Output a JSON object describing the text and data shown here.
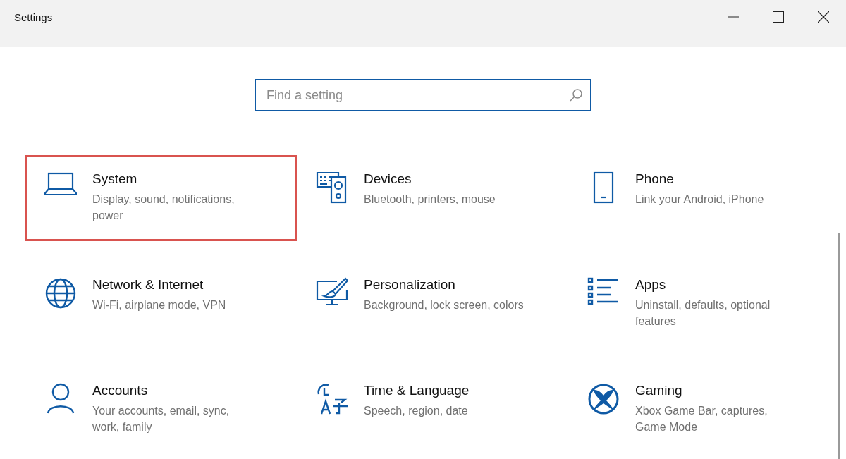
{
  "window": {
    "title": "Settings"
  },
  "search": {
    "placeholder": "Find a setting"
  },
  "categories": [
    {
      "kind": "system",
      "title": "System",
      "subtitle": "Display, sound, notifications, power",
      "highlighted": true
    },
    {
      "kind": "devices",
      "title": "Devices",
      "subtitle": "Bluetooth, printers, mouse",
      "highlighted": false
    },
    {
      "kind": "phone",
      "title": "Phone",
      "subtitle": "Link your Android, iPhone",
      "highlighted": false
    },
    {
      "kind": "network",
      "title": "Network & Internet",
      "subtitle": "Wi-Fi, airplane mode, VPN",
      "highlighted": false
    },
    {
      "kind": "personalization",
      "title": "Personalization",
      "subtitle": "Background, lock screen, colors",
      "highlighted": false
    },
    {
      "kind": "apps",
      "title": "Apps",
      "subtitle": "Uninstall, defaults, optional features",
      "highlighted": false
    },
    {
      "kind": "accounts",
      "title": "Accounts",
      "subtitle": "Your accounts, email, sync, work, family",
      "highlighted": false
    },
    {
      "kind": "time",
      "title": "Time & Language",
      "subtitle": "Speech, region, date",
      "highlighted": false
    },
    {
      "kind": "gaming",
      "title": "Gaming",
      "subtitle": "Xbox Game Bar, captures, Game Mode",
      "highlighted": false
    }
  ]
}
